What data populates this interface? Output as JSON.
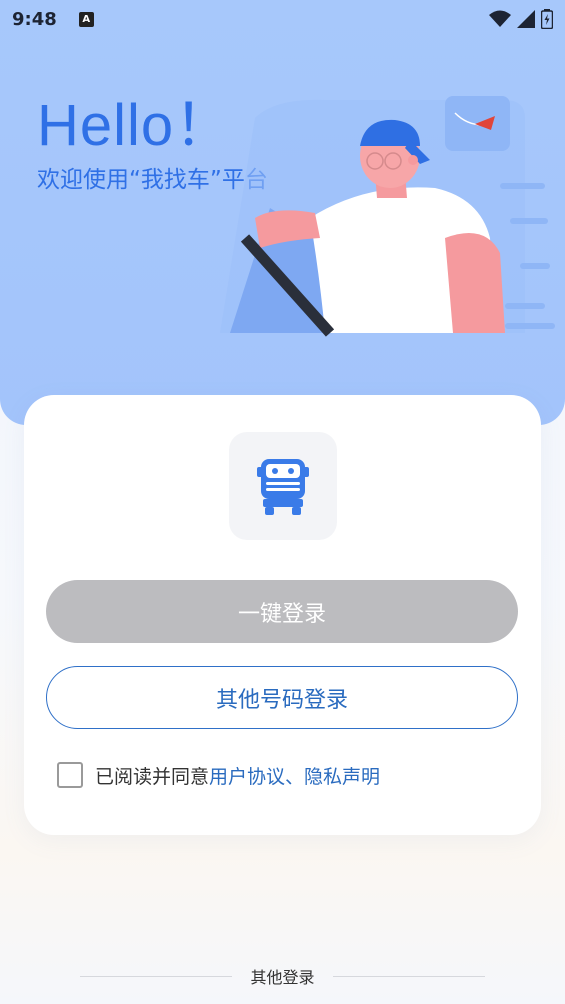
{
  "status_bar": {
    "time": "9:48",
    "notification_glyph": "A",
    "icons": [
      "wifi-icon",
      "signal-icon",
      "battery-icon"
    ]
  },
  "hero": {
    "greeting": "Hello！",
    "subtitle": "欢迎使用“我找车”平台"
  },
  "card": {
    "logo_icon": "truck-icon",
    "onekey_login_label": "一键登录",
    "other_number_login_label": "其他号码登录",
    "agreement": {
      "prefix": "已阅读并同意",
      "user_agreement": "用户协议",
      "separator": "、",
      "privacy_statement": "隐私声明"
    }
  },
  "footer": {
    "other_login_label": "其他登录"
  },
  "colors": {
    "accent": "#2f70e6",
    "link": "#2a6bbf",
    "hero_bg": "#a7c8fb",
    "disabled_button": "#bcbcbf"
  }
}
